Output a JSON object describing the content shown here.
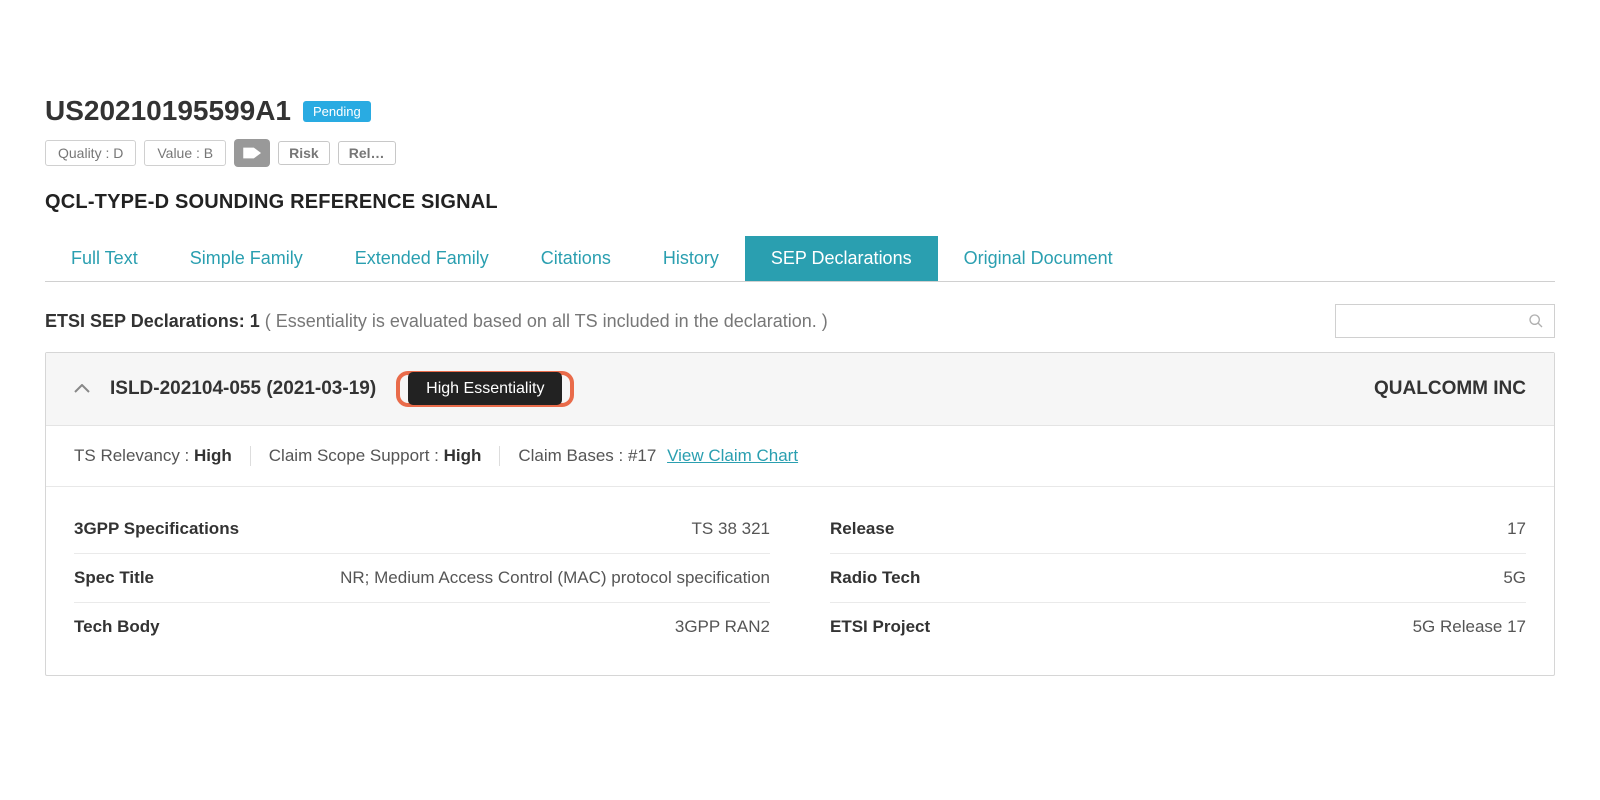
{
  "header": {
    "patent_id": "US20210195599A1",
    "status": "Pending",
    "quality_label": "Quality :  D",
    "value_label": "Value :  B",
    "risk_btn": "Risk",
    "rel_btn": "Rel…",
    "title": "QCL-TYPE-D SOUNDING REFERENCE SIGNAL"
  },
  "tabs": [
    {
      "label": "Full Text"
    },
    {
      "label": "Simple Family"
    },
    {
      "label": "Extended Family"
    },
    {
      "label": "Citations"
    },
    {
      "label": "History"
    },
    {
      "label": "SEP Declarations"
    },
    {
      "label": "Original Document"
    }
  ],
  "declarations": {
    "label_prefix": "ETSI SEP Declarations: ",
    "count": "1",
    "note": " ( Essentiality is evaluated based on all TS included in the declaration. )"
  },
  "card": {
    "decl_id": "ISLD-202104-055 (2021-03-19)",
    "essentiality": "High Essentiality",
    "company": "QUALCOMM INC",
    "meta": {
      "ts_relevancy_label": "TS Relevancy : ",
      "ts_relevancy_value": "High",
      "claim_scope_label": "Claim Scope Support : ",
      "claim_scope_value": "High",
      "claim_bases_label": "Claim Bases : #17",
      "claim_chart_link": "View Claim Chart"
    },
    "left": [
      {
        "label": "3GPP Specifications",
        "value": "TS 38 321"
      },
      {
        "label": "Spec Title",
        "value": "NR; Medium Access Control (MAC) protocol specification"
      },
      {
        "label": "Tech Body",
        "value": "3GPP RAN2"
      }
    ],
    "right": [
      {
        "label": "Release",
        "value": "17"
      },
      {
        "label": "Radio Tech",
        "value": "5G"
      },
      {
        "label": "ETSI Project",
        "value": "5G Release 17"
      }
    ]
  }
}
